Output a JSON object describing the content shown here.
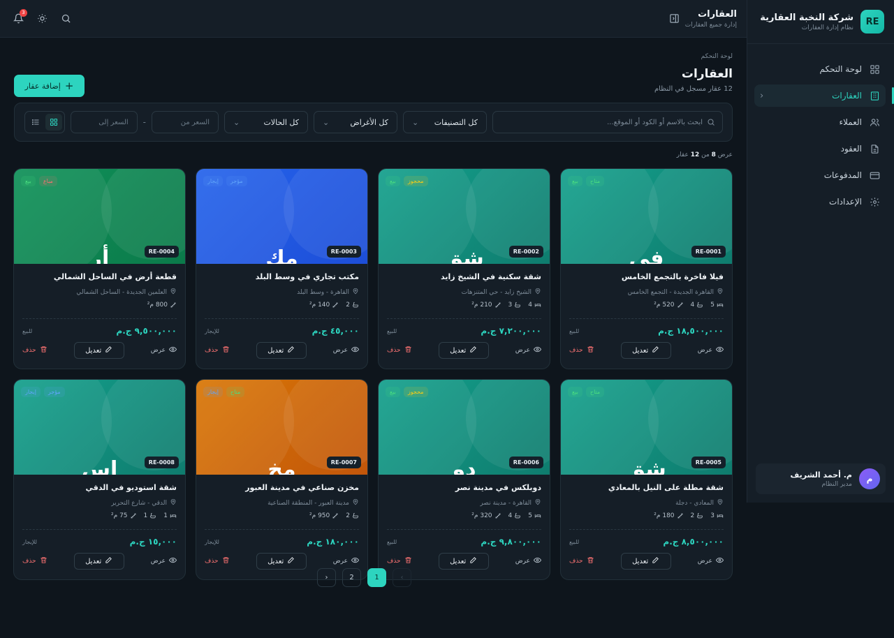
{
  "brand": {
    "logo": "RE",
    "name": "شركة النخبة العقارية",
    "subtitle": "نظام إدارة العقارات"
  },
  "nav": [
    {
      "label": "لوحة التحكم",
      "icon": "grid-icon"
    },
    {
      "label": "العقارات",
      "icon": "building-icon",
      "active": true
    },
    {
      "label": "العملاء",
      "icon": "users-icon"
    },
    {
      "label": "العقود",
      "icon": "document-icon"
    },
    {
      "label": "المدفوعات",
      "icon": "card-icon"
    },
    {
      "label": "الإعدادات",
      "icon": "gear-icon"
    }
  ],
  "user": {
    "initial": "م",
    "name": "م. أحمد الشريف",
    "role": "مدير النظام"
  },
  "topbar": {
    "title": "العقارات",
    "subtitle": "إدارة جميع العقارات",
    "notif_count": "3"
  },
  "page": {
    "breadcrumb": "لوحة التحكم",
    "title": "العقارات",
    "subtitle": "12 عقار مسجل في النظام",
    "add_label": "إضافة عقار"
  },
  "filters": {
    "search_placeholder": "ابحث بالاسم أو الكود أو الموقع...",
    "category": "كل التصنيفات",
    "purpose": "كل الأغراض",
    "status": "كل الحالات",
    "price_from": "السعر من",
    "price_to": "السعر إلى"
  },
  "count": {
    "prefix": "عرض",
    "shown": "8",
    "mid": "من",
    "total": "12",
    "suffix": "عقار"
  },
  "actions": {
    "view": "عرض",
    "edit": "تعديل",
    "delete": "حذف"
  },
  "cards": [
    {
      "code": "RE-0001",
      "initials": "فی",
      "title": "فيلا فاخرة بالتجمع الخامس",
      "location": "القاهرة الجديدة - التجمع الخامس",
      "beds": "5",
      "baths": "4",
      "area": "520 م²",
      "price": "١٨,٥٠٠,٠٠٠ ج.م",
      "type": "للبيع",
      "tags": [
        "بيع",
        "متاح"
      ],
      "colors": [
        "#0f7c6e",
        "#14a08c"
      ]
    },
    {
      "code": "RE-0002",
      "initials": "شق",
      "title": "شقة سكنية في الشيخ زايد",
      "location": "الشيخ زايد - حي المتنزهات",
      "beds": "4",
      "baths": "3",
      "area": "210 م²",
      "price": "٧,٢٠٠,٠٠٠ ج.م",
      "type": "للبيع",
      "tags": [
        "بيع",
        "محجوز"
      ],
      "colors": [
        "#0f7c6e",
        "#14a08c"
      ]
    },
    {
      "code": "RE-0003",
      "initials": "مك",
      "title": "مكتب تجاري في وسط البلد",
      "location": "القاهرة - وسط البلد",
      "beds": "",
      "baths": "2",
      "area": "140 م²",
      "price": "٤٥,٠٠٠ ج.م",
      "type": "للإيجار",
      "tags": [
        "إيجار",
        "مؤجر"
      ],
      "colors": [
        "#1d4ed8",
        "#2563eb"
      ]
    },
    {
      "code": "RE-0004",
      "initials": "أر",
      "title": "قطعة أرض في الساحل الشمالي",
      "location": "العلمين الجديدة - الساحل الشمالي",
      "beds": "",
      "baths": "",
      "area": "800 م²",
      "price": "٩,٥٠٠,٠٠٠ ج.م",
      "type": "للبيع",
      "tags": [
        "بيع",
        "مباع"
      ],
      "colors": [
        "#0b7a4a",
        "#109159"
      ]
    },
    {
      "code": "RE-0005",
      "initials": "شق",
      "title": "شقة مطلة على النيل بالمعادي",
      "location": "المعادي - دجلة",
      "beds": "3",
      "baths": "2",
      "area": "180 م²",
      "price": "٨,٥٠٠,٠٠٠ ج.م",
      "type": "للبيع",
      "tags": [
        "بيع",
        "متاح"
      ],
      "colors": [
        "#0f7c6e",
        "#14a08c"
      ]
    },
    {
      "code": "RE-0006",
      "initials": "دو",
      "title": "دوبلكس في مدينة نصر",
      "location": "القاهرة - مدينة نصر",
      "beds": "5",
      "baths": "4",
      "area": "320 م²",
      "price": "٩,٨٠٠,٠٠٠ ج.م",
      "type": "للبيع",
      "tags": [
        "بيع",
        "محجوز"
      ],
      "colors": [
        "#0f7c6e",
        "#14a08c"
      ]
    },
    {
      "code": "RE-0007",
      "initials": "مخ",
      "title": "مخزن صناعي في مدينة العبور",
      "location": "مدينة العبور - المنطقة الصناعية",
      "beds": "",
      "baths": "2",
      "area": "950 م²",
      "price": "١٨٠,٠٠٠ ج.م",
      "type": "للإيجار",
      "tags": [
        "إيجار",
        "متاح"
      ],
      "colors": [
        "#c2560a",
        "#d97706"
      ]
    },
    {
      "code": "RE-0008",
      "initials": "اس",
      "title": "شقة استوديو في الدقي",
      "location": "الدقي - شارع التحرير",
      "beds": "1",
      "baths": "1",
      "area": "75 م²",
      "price": "١٥,٠٠٠ ج.م",
      "type": "للإيجار",
      "tags": [
        "إيجار",
        "مؤجر"
      ],
      "colors": [
        "#0f7c6e",
        "#14a08c"
      ]
    }
  ],
  "tag_colors": {
    "بيع": "#4ade80",
    "متاح": "#4ade80",
    "محجوز": "#facc15",
    "إيجار": "#60a5fa",
    "مؤجر": "#60a5fa",
    "مباع": "#f87171"
  },
  "pagination": {
    "prev": "‹",
    "pages": [
      "1",
      "2"
    ],
    "current": "1",
    "next": "›"
  }
}
